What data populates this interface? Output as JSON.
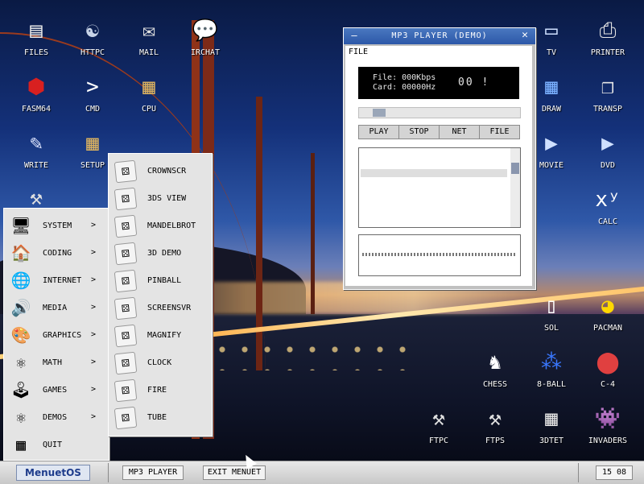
{
  "desktop": {
    "icons": [
      {
        "id": "files",
        "label": "FILES",
        "glyph": "▤",
        "icon": "files-icon",
        "color": "#e8e8e8"
      },
      {
        "id": "httpc",
        "label": "HTTPC",
        "glyph": "☯",
        "icon": "yin-yang-icon",
        "color": "#c8d4e8"
      },
      {
        "id": "mail",
        "label": "MAIL",
        "glyph": "✉",
        "icon": "envelope-icon",
        "color": "#e0e0e0"
      },
      {
        "id": "irchat",
        "label": "IRCHAT",
        "glyph": "💬",
        "icon": "chat-bubble-icon",
        "color": "#f08020"
      },
      {
        "id": "fasm64",
        "label": "FASM64",
        "glyph": "⬢",
        "icon": "fasm-ball-icon",
        "color": "#d82020"
      },
      {
        "id": "cmd",
        "label": "CMD",
        "glyph": ">",
        "icon": "terminal-icon",
        "color": "#ffffff"
      },
      {
        "id": "cpu",
        "label": "CPU",
        "glyph": "▦",
        "icon": "chip-icon",
        "color": "#d8b060"
      },
      {
        "id": "write",
        "label": "WRITE",
        "glyph": "✎",
        "icon": "pen-paper-icon",
        "color": "#dfe6ff"
      },
      {
        "id": "setup",
        "label": "SETUP",
        "glyph": "▦",
        "icon": "setup-chip-icon",
        "color": "#d8b060"
      },
      {
        "id": "tools",
        "label": "",
        "glyph": "⚒",
        "icon": "hammer-wrench-icon",
        "color": "#e0e0e0"
      },
      {
        "id": "tv",
        "label": "TV",
        "glyph": "▭",
        "icon": "monitor-icon",
        "color": "#cfe0ff"
      },
      {
        "id": "printer",
        "label": "PRINTER",
        "glyph": "⎙",
        "icon": "printer-icon",
        "color": "#e6e6e6"
      },
      {
        "id": "draw",
        "label": "DRAW",
        "glyph": "▦",
        "icon": "palette-grid-icon",
        "color": "#7ab0ff"
      },
      {
        "id": "transp",
        "label": "TRANSP",
        "glyph": "❐",
        "icon": "window-stack-icon",
        "color": "#e6e6e6"
      },
      {
        "id": "movie",
        "label": "MOVIE",
        "glyph": "▶",
        "icon": "movie-screen-icon",
        "color": "#cfe0ff"
      },
      {
        "id": "dvd",
        "label": "DVD",
        "glyph": "▶",
        "icon": "dvd-screen-icon",
        "color": "#cfe0ff"
      },
      {
        "id": "calc",
        "label": "CALC",
        "glyph": "xʸ",
        "icon": "calculator-icon",
        "color": "#ffffff"
      },
      {
        "id": "sol",
        "label": "SOL",
        "glyph": "▯",
        "icon": "playing-card-icon",
        "color": "#ffffff"
      },
      {
        "id": "pacman",
        "label": "PACMAN",
        "glyph": "◕",
        "icon": "pacman-icon",
        "color": "#ffd800"
      },
      {
        "id": "chess",
        "label": "CHESS",
        "glyph": "♞",
        "icon": "chess-knight-icon",
        "color": "#ffffff"
      },
      {
        "id": "8ball",
        "label": "8-BALL",
        "glyph": "⁂",
        "icon": "billiard-balls-icon",
        "color": "#3a78ff"
      },
      {
        "id": "c4",
        "label": "C-4",
        "glyph": "⬤",
        "icon": "connect-four-icon",
        "color": "#e04040"
      },
      {
        "id": "ftpc",
        "label": "FTPC",
        "glyph": "⚒",
        "icon": "ftpc-tools-icon",
        "color": "#e0e0e0"
      },
      {
        "id": "ftps",
        "label": "FTPS",
        "glyph": "⚒",
        "icon": "ftps-tools-icon",
        "color": "#e0e0e0"
      },
      {
        "id": "3dtet",
        "label": "3DTET",
        "glyph": "▦",
        "icon": "tetris-grid-icon",
        "color": "#e0e0e0"
      },
      {
        "id": "invaders",
        "label": "INVADERS",
        "glyph": "👾",
        "icon": "space-invader-icon",
        "color": "#c050ff"
      }
    ]
  },
  "mp3_window": {
    "title": "MP3 PLAYER (DEMO)",
    "minimize_glyph": "—",
    "close_glyph": "✕",
    "menu_file": "FILE",
    "file_rate": "File: 000Kbps",
    "card_rate": "Card: 00000Hz",
    "counter": "00 !",
    "buttons": {
      "play": "PLAY",
      "stop": "STOP",
      "net": "NET",
      "file": "FILE"
    },
    "seek_value": 0.09
  },
  "start_menu": {
    "items": [
      {
        "label": "SYSTEM",
        "arrow": ">",
        "glyph": "🖥",
        "icon": "system-monitor-icon"
      },
      {
        "label": "CODING",
        "arrow": ">",
        "glyph": "🏠",
        "icon": "house-icon"
      },
      {
        "label": "INTERNET",
        "arrow": ">",
        "glyph": "🌐",
        "icon": "globe-icon"
      },
      {
        "label": "MEDIA",
        "arrow": ">",
        "glyph": "🔊",
        "icon": "speaker-icon"
      },
      {
        "label": "GRAPHICS",
        "arrow": ">",
        "glyph": "🎨",
        "icon": "palette-icon"
      },
      {
        "label": "MATH",
        "arrow": ">",
        "glyph": "⚛",
        "icon": "molecule-icon"
      },
      {
        "label": "GAMES",
        "arrow": ">",
        "glyph": "🕹",
        "icon": "joystick-icon"
      },
      {
        "label": "DEMOS",
        "arrow": ">",
        "glyph": "⚛",
        "icon": "demos-molecule-icon"
      },
      {
        "label": "QUIT",
        "arrow": "",
        "glyph": "▦",
        "icon": "quit-chip-icon"
      }
    ]
  },
  "submenu": {
    "items": [
      {
        "label": "CROWNSCR",
        "glyph": "⚄"
      },
      {
        "label": "3DS VIEW",
        "glyph": "⚄"
      },
      {
        "label": "MANDELBROT",
        "glyph": "⚄"
      },
      {
        "label": "3D DEMO",
        "glyph": "⚄"
      },
      {
        "label": "PINBALL",
        "glyph": "⚄"
      },
      {
        "label": "SCREENSVR",
        "glyph": "⚄"
      },
      {
        "label": "MAGNIFY",
        "glyph": "⚄"
      },
      {
        "label": "CLOCK",
        "glyph": "⚄"
      },
      {
        "label": "FIRE",
        "glyph": "⚄"
      },
      {
        "label": "TUBE",
        "glyph": "⚄"
      }
    ]
  },
  "taskbar": {
    "start_label": "MenuetOS",
    "tasks": [
      "MP3 PLAYER",
      "EXIT MENUET"
    ],
    "clock": "15 08"
  }
}
